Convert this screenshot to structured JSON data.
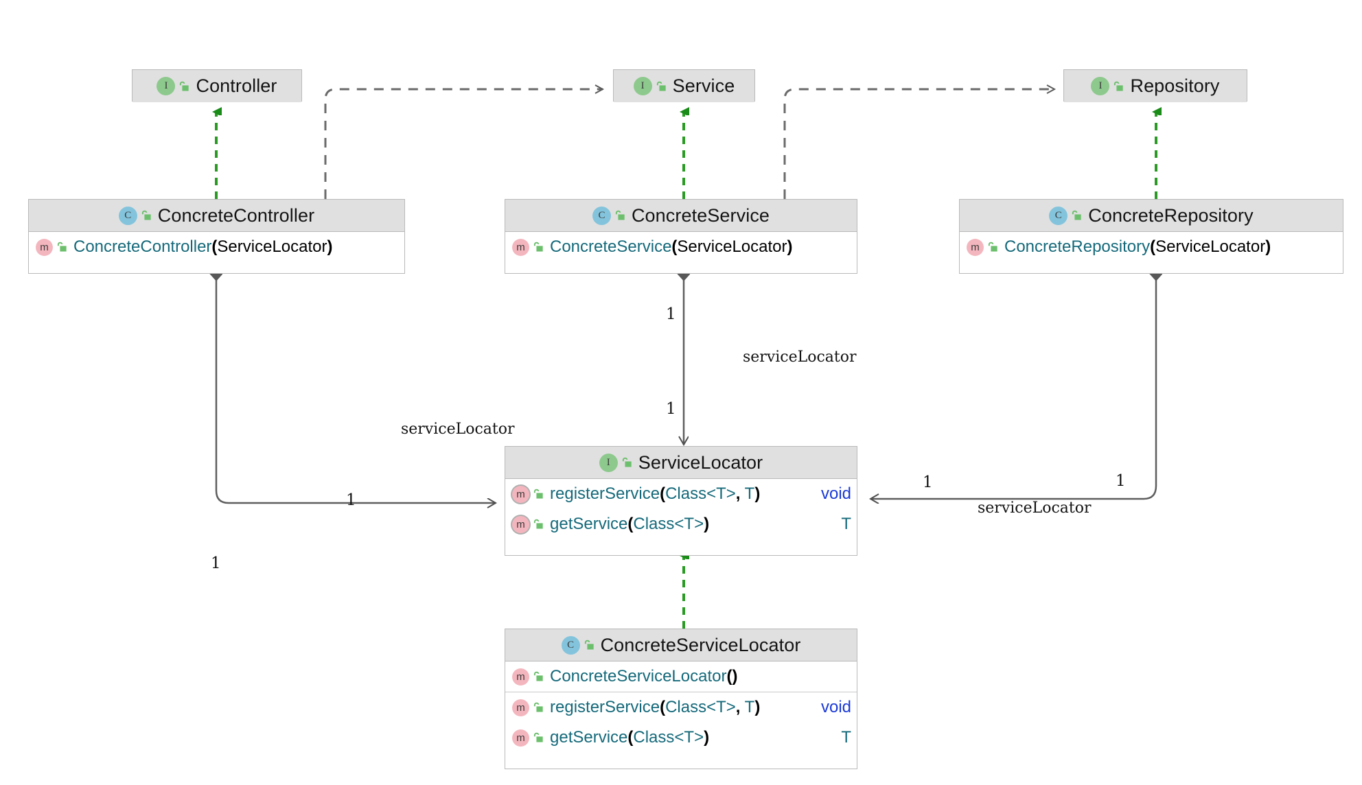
{
  "diagram": {
    "title": "Service Locator pattern UML class diagram",
    "type": "uml-class-diagram",
    "colors": {
      "header_fill": "#e0e0e0",
      "body_fill": "#ffffff",
      "border": "#b9b9b9",
      "interface_badge": "#8dc98d",
      "class_badge": "#83c4dc",
      "method_badge": "#f4b6be",
      "lock_green": "#6cbf6c",
      "realization_green": "#1a8a18",
      "dependency_gray": "#6a6a6a",
      "association_gray": "#5e5e5e",
      "member_name": "#15697a",
      "void_type": "#1a39d6"
    }
  },
  "nodes": [
    {
      "id": "controller",
      "stereotype": "interface",
      "badge_letter": "I",
      "name": "Controller",
      "members": []
    },
    {
      "id": "service",
      "stereotype": "interface",
      "badge_letter": "I",
      "name": "Service",
      "members": []
    },
    {
      "id": "repository",
      "stereotype": "interface",
      "badge_letter": "I",
      "name": "Repository",
      "members": []
    },
    {
      "id": "concrete_controller",
      "stereotype": "class",
      "badge_letter": "C",
      "name": "ConcreteController",
      "members": [
        {
          "kind": "method",
          "abstract": false,
          "name": "ConcreteController",
          "params": "ServiceLocator",
          "signature": "ConcreteController(ServiceLocator)",
          "return": ""
        }
      ]
    },
    {
      "id": "concrete_service",
      "stereotype": "class",
      "badge_letter": "C",
      "name": "ConcreteService",
      "members": [
        {
          "kind": "method",
          "abstract": false,
          "name": "ConcreteService",
          "params": "ServiceLocator",
          "signature": "ConcreteService(ServiceLocator)",
          "return": ""
        }
      ]
    },
    {
      "id": "concrete_repository",
      "stereotype": "class",
      "badge_letter": "C",
      "name": "ConcreteRepository",
      "members": [
        {
          "kind": "method",
          "abstract": false,
          "name": "ConcreteRepository",
          "params": "ServiceLocator",
          "signature": "ConcreteRepository(ServiceLocator)",
          "return": ""
        }
      ]
    },
    {
      "id": "service_locator",
      "stereotype": "interface",
      "badge_letter": "I",
      "name": "ServiceLocator",
      "members": [
        {
          "kind": "method",
          "abstract": true,
          "name": "registerService",
          "params": "Class<T>, T",
          "signature": "registerService(Class<T>, T)",
          "return": "void"
        },
        {
          "kind": "method",
          "abstract": true,
          "name": "getService",
          "params": "Class<T>",
          "signature": "getService(Class<T>)",
          "return": "T"
        }
      ]
    },
    {
      "id": "concrete_service_locator",
      "stereotype": "class",
      "badge_letter": "C",
      "name": "ConcreteServiceLocator",
      "members": [
        {
          "kind": "method",
          "abstract": false,
          "name": "ConcreteServiceLocator",
          "params": "",
          "signature": "ConcreteServiceLocator()",
          "return": ""
        },
        {
          "kind": "method",
          "abstract": false,
          "name": "registerService",
          "params": "Class<T>, T",
          "signature": "registerService(Class<T>, T)",
          "return": "void"
        },
        {
          "kind": "method",
          "abstract": false,
          "name": "getService",
          "params": "Class<T>",
          "signature": "getService(Class<T>)",
          "return": "T"
        }
      ]
    }
  ],
  "edges": [
    {
      "id": "e1",
      "kind": "realization",
      "from": "concrete_controller",
      "to": "controller",
      "label": "",
      "source_mult": "",
      "target_mult": ""
    },
    {
      "id": "e2",
      "kind": "realization",
      "from": "concrete_service",
      "to": "service",
      "label": "",
      "source_mult": "",
      "target_mult": ""
    },
    {
      "id": "e3",
      "kind": "realization",
      "from": "concrete_repository",
      "to": "repository",
      "label": "",
      "source_mult": "",
      "target_mult": ""
    },
    {
      "id": "e4",
      "kind": "realization",
      "from": "concrete_service_locator",
      "to": "service_locator",
      "label": "",
      "source_mult": "",
      "target_mult": ""
    },
    {
      "id": "e5",
      "kind": "dependency",
      "from": "concrete_controller",
      "to": "service",
      "label": "",
      "source_mult": "",
      "target_mult": ""
    },
    {
      "id": "e6",
      "kind": "dependency",
      "from": "concrete_service",
      "to": "repository",
      "label": "",
      "source_mult": "",
      "target_mult": ""
    },
    {
      "id": "e7",
      "kind": "composition",
      "from": "concrete_controller",
      "to": "service_locator",
      "label": "serviceLocator",
      "source_mult": "1",
      "target_mult": "1"
    },
    {
      "id": "e8",
      "kind": "composition",
      "from": "concrete_service",
      "to": "service_locator",
      "label": "serviceLocator",
      "source_mult": "1",
      "target_mult": "1"
    },
    {
      "id": "e9",
      "kind": "composition",
      "from": "concrete_repository",
      "to": "service_locator",
      "label": "serviceLocator",
      "source_mult": "1",
      "target_mult": "1"
    }
  ],
  "edge_labels": [
    {
      "id": "l1",
      "text": "1",
      "kind": "multiplicity"
    },
    {
      "id": "l2",
      "text": "serviceLocator",
      "kind": "role"
    },
    {
      "id": "l3",
      "text": "1",
      "kind": "multiplicity"
    },
    {
      "id": "l4",
      "text": "serviceLocator",
      "kind": "role"
    },
    {
      "id": "l5",
      "text": "1",
      "kind": "multiplicity"
    },
    {
      "id": "l6",
      "text": "1",
      "kind": "multiplicity"
    },
    {
      "id": "l7",
      "text": "1",
      "kind": "multiplicity"
    },
    {
      "id": "l8",
      "text": "1",
      "kind": "multiplicity"
    },
    {
      "id": "l9",
      "text": "serviceLocator",
      "kind": "role"
    }
  ]
}
